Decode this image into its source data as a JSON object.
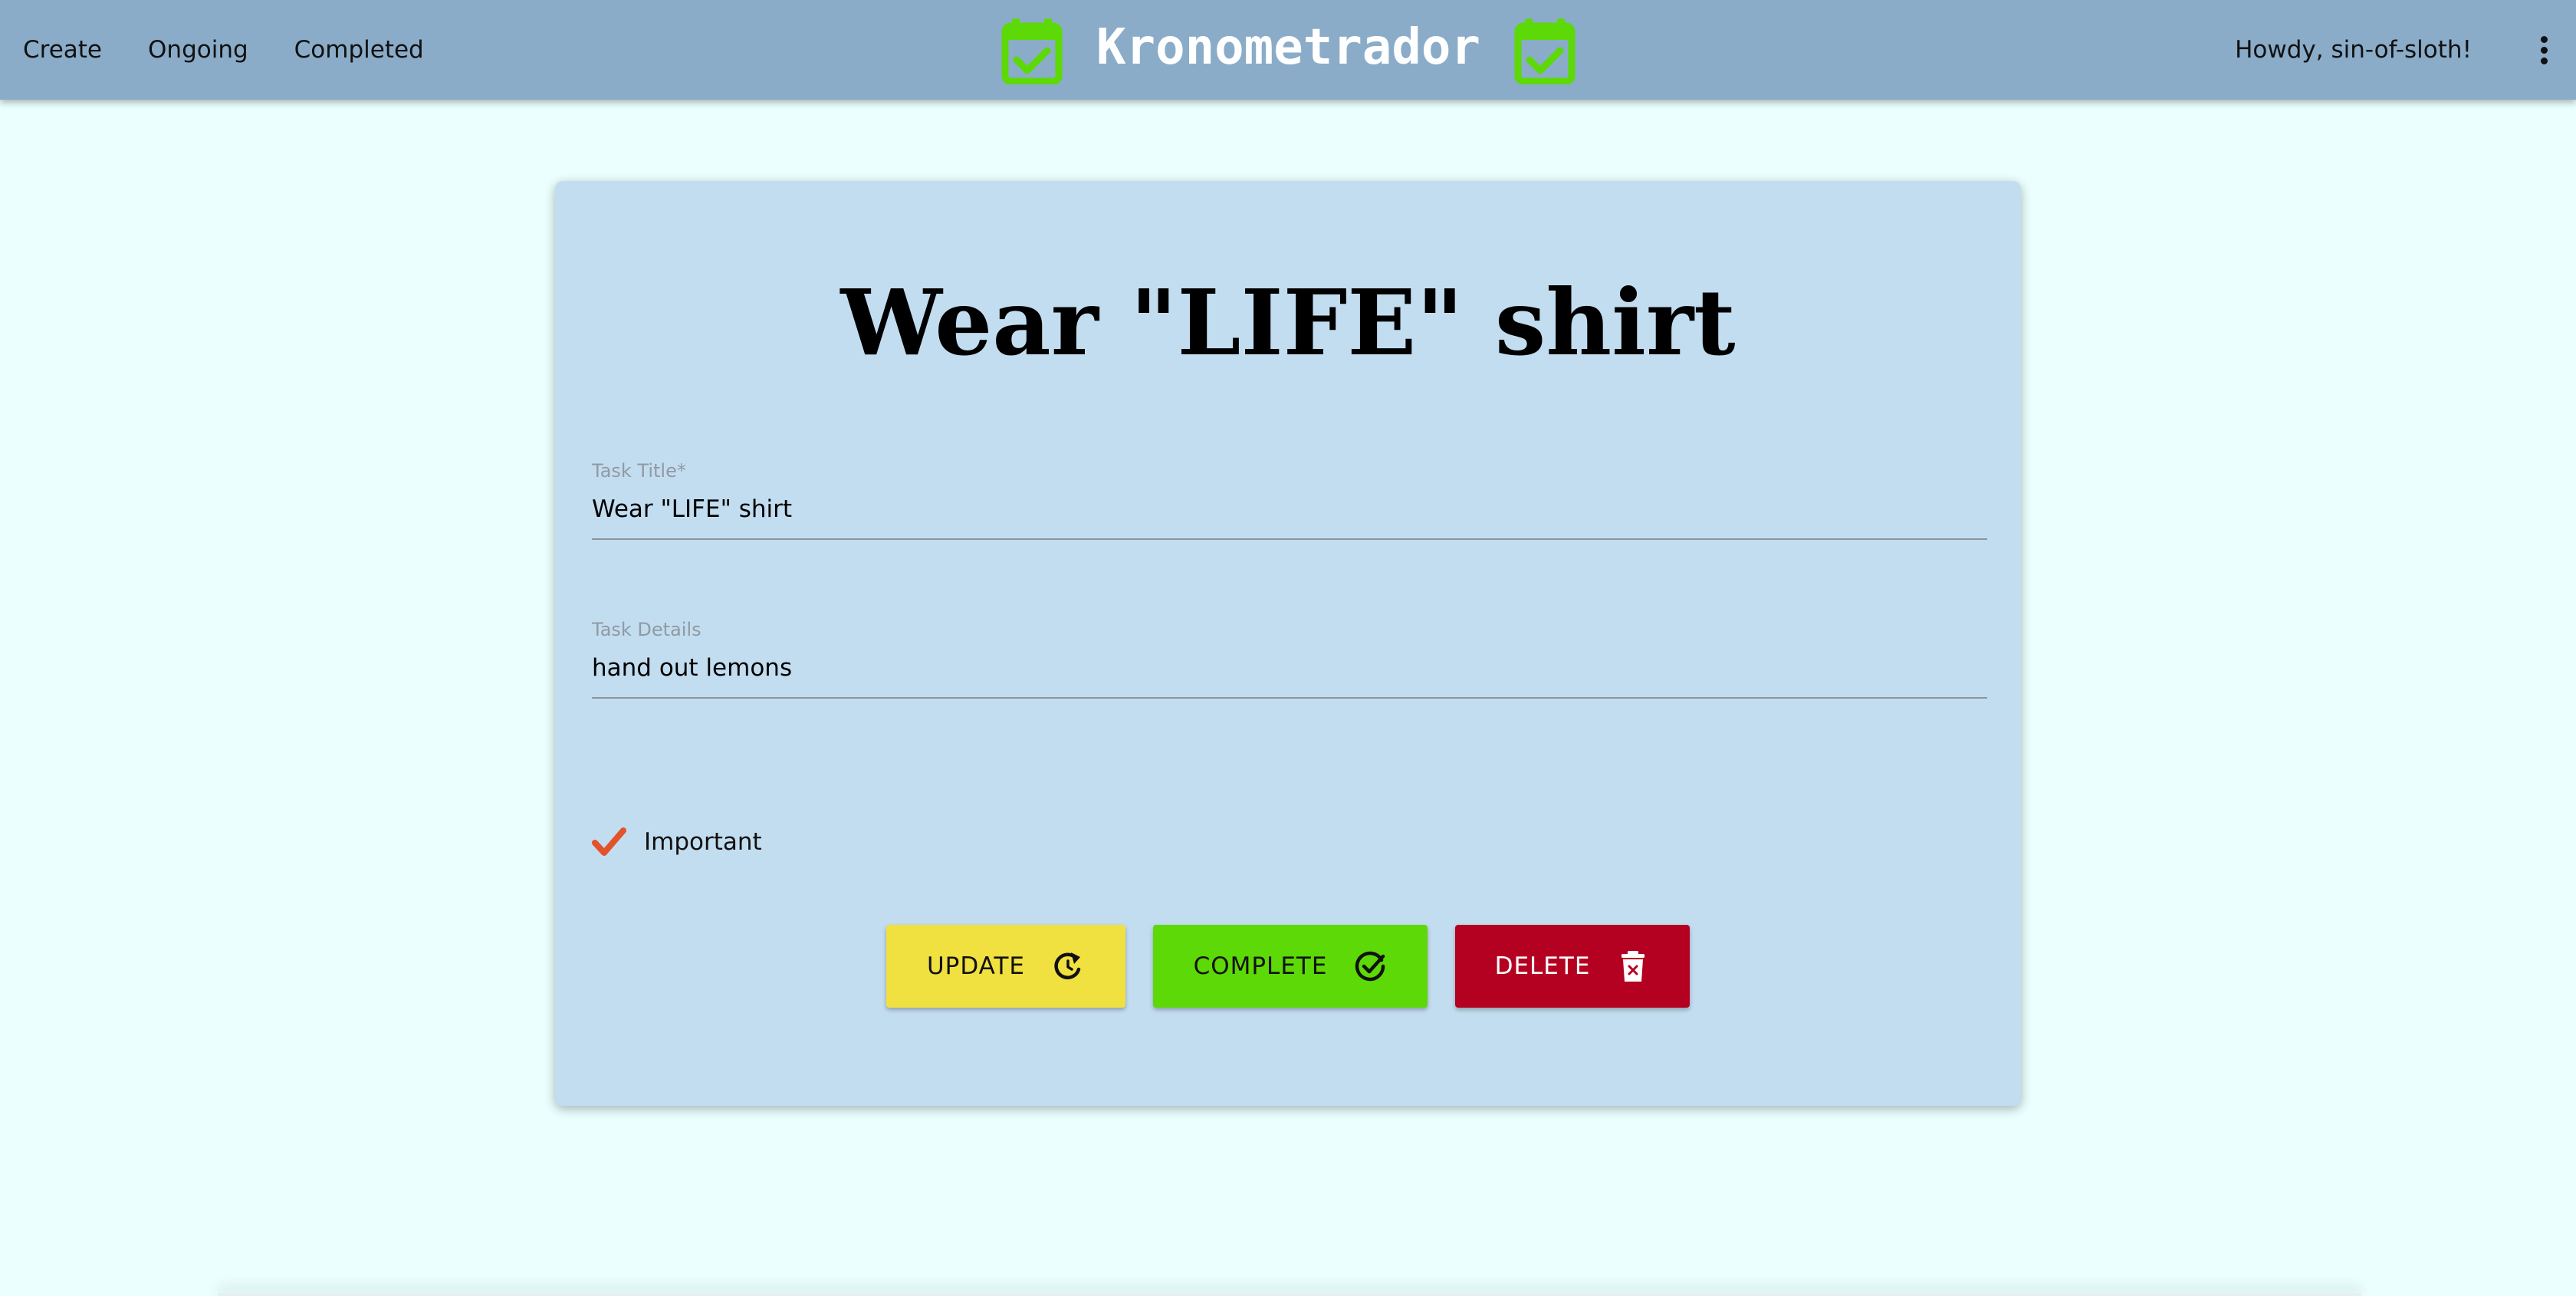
{
  "nav": {
    "links": [
      {
        "label": "Create"
      },
      {
        "label": "Ongoing"
      },
      {
        "label": "Completed"
      }
    ],
    "brand": "Kronometrador",
    "brand_icon": "calendar-check-icon",
    "greeting": "Howdy, sin-of-sloth!",
    "menu_icon": "more-vertical-icon"
  },
  "task": {
    "heading": "Wear \"LIFE\" shirt",
    "title_label": "Task Title*",
    "title_value": "Wear \"LIFE\" shirt",
    "details_label": "Task Details",
    "details_value": "hand out lemons",
    "important_label": "Important",
    "important_checked": true
  },
  "buttons": {
    "update": {
      "label": "UPDATE",
      "icon": "refresh-icon"
    },
    "complete": {
      "label": "COMPLETE",
      "icon": "check-circle-icon"
    },
    "delete": {
      "label": "DELETE",
      "icon": "trash-icon"
    }
  },
  "colors": {
    "navbar": "#8aacc8",
    "page_background": "#eafffe",
    "card": "#c3ddf0",
    "brand_icon": "#5cd906",
    "important_check": "#e2522b",
    "update": "#f0e040",
    "complete": "#5cd906",
    "delete": "#b40021"
  }
}
